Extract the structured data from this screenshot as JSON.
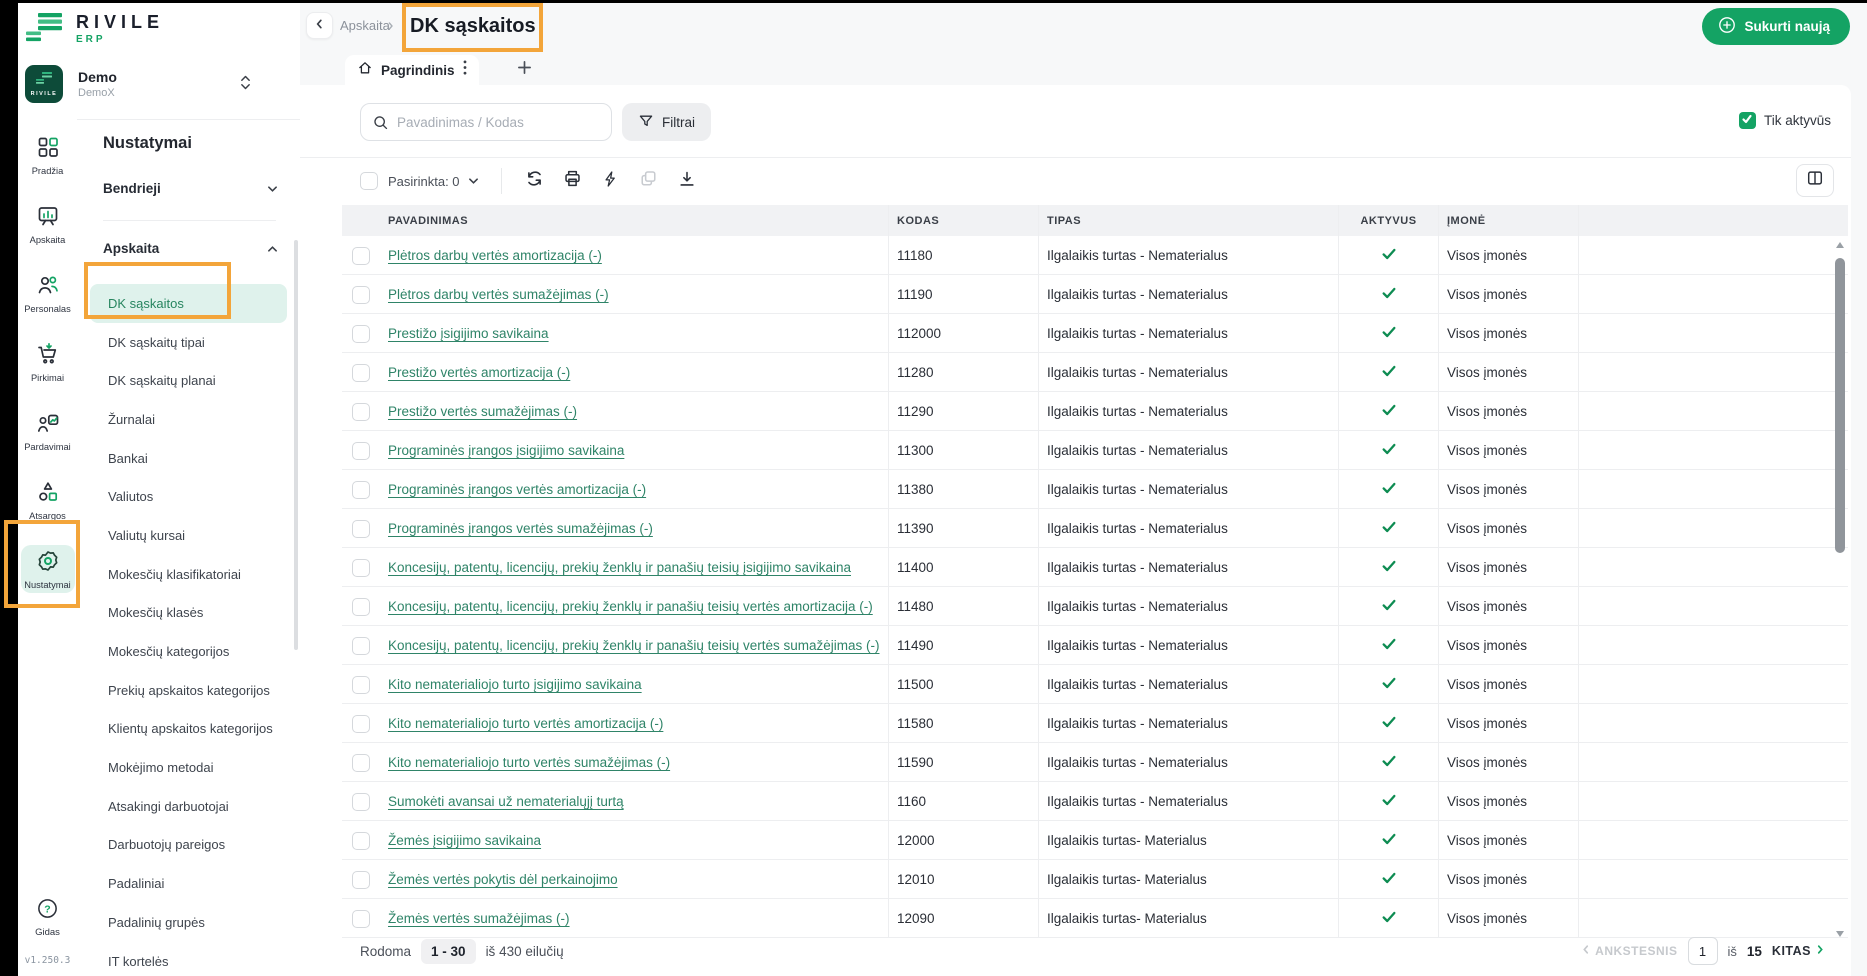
{
  "brand": {
    "name": "RIVILE",
    "suffix": "ERP"
  },
  "workspace": {
    "name": "Demo",
    "subtitle": "DemoX"
  },
  "rail": {
    "items": [
      {
        "label": "Pradžia",
        "icon": "dashboard-icon"
      },
      {
        "label": "Apskaita",
        "icon": "accounting-icon"
      },
      {
        "label": "Personalas",
        "icon": "people-icon"
      },
      {
        "label": "Pirkimai",
        "icon": "cart-icon"
      },
      {
        "label": "Pardavimai",
        "icon": "sales-icon"
      },
      {
        "label": "Atsargos",
        "icon": "inventory-shapes-icon"
      },
      {
        "label": "Nustatymai",
        "icon": "gear-icon",
        "active": true
      }
    ],
    "guide_label": "Gidas",
    "version": "v1.250.3"
  },
  "sidebar": {
    "title": "Nustatymai",
    "group_general": "Bendrieji",
    "group_accounting": "Apskaita",
    "items": [
      {
        "label": "DK sąskaitos",
        "active": true
      },
      {
        "label": "DK sąskaitų tipai"
      },
      {
        "label": "DK sąskaitų planai"
      },
      {
        "label": "Žurnalai"
      },
      {
        "label": "Bankai"
      },
      {
        "label": "Valiutos"
      },
      {
        "label": "Valiutų kursai"
      },
      {
        "label": "Mokesčių klasifikatoriai"
      },
      {
        "label": "Mokesčių klasės"
      },
      {
        "label": "Mokesčių kategorijos"
      },
      {
        "label": "Prekių apskaitos kategorijos"
      },
      {
        "label": "Klientų apskaitos kategorijos"
      },
      {
        "label": "Mokėjimo metodai"
      },
      {
        "label": "Atsakingi darbuotojai"
      },
      {
        "label": "Darbuotojų pareigos"
      },
      {
        "label": "Padaliniai"
      },
      {
        "label": "Padalinių grupės"
      },
      {
        "label": "IT kortelės"
      }
    ]
  },
  "header": {
    "breadcrumb_parent": "Apskaita",
    "title": "DK sąskaitos",
    "create_button": "Sukurti naują"
  },
  "tabs": {
    "active_label": "Pagrindinis"
  },
  "filters": {
    "search_placeholder": "Pavadinimas / Kodas",
    "filter_button": "Filtrai",
    "active_only_label": "Tik aktyvūs",
    "active_only_checked": true
  },
  "toolbar": {
    "selected_label": "Pasirinkta: 0"
  },
  "table": {
    "columns": {
      "name": "PAVADINIMAS",
      "code": "KODAS",
      "type": "TIPAS",
      "active": "AKTYVUS",
      "company": "ĮMONĖ"
    },
    "rows": [
      {
        "name": "Plėtros darbų vertės amortizacija (-)",
        "code": "11180",
        "type": "Ilgalaikis turtas - Nematerialus",
        "active": true,
        "company": "Visos įmonės"
      },
      {
        "name": "Plėtros darbų vertės sumažėjimas (-)",
        "code": "11190",
        "type": "Ilgalaikis turtas - Nematerialus",
        "active": true,
        "company": "Visos įmonės"
      },
      {
        "name": "Prestižo įsigijimo savikaina",
        "code": "112000",
        "type": "Ilgalaikis turtas - Nematerialus",
        "active": true,
        "company": "Visos įmonės"
      },
      {
        "name": "Prestižo vertės amortizacija (-)",
        "code": "11280",
        "type": "Ilgalaikis turtas - Nematerialus",
        "active": true,
        "company": "Visos įmonės"
      },
      {
        "name": "Prestižo vertės sumažėjimas (-)",
        "code": "11290",
        "type": "Ilgalaikis turtas - Nematerialus",
        "active": true,
        "company": "Visos įmonės"
      },
      {
        "name": "Programinės įrangos įsigijimo savikaina",
        "code": "11300",
        "type": "Ilgalaikis turtas - Nematerialus",
        "active": true,
        "company": "Visos įmonės"
      },
      {
        "name": "Programinės įrangos vertės amortizacija (-)",
        "code": "11380",
        "type": "Ilgalaikis turtas - Nematerialus",
        "active": true,
        "company": "Visos įmonės"
      },
      {
        "name": "Programinės įrangos vertės sumažėjimas (-)",
        "code": "11390",
        "type": "Ilgalaikis turtas - Nematerialus",
        "active": true,
        "company": "Visos įmonės"
      },
      {
        "name": "Koncesijų, patentų, licencijų, prekių ženklų ir panašių teisių įsigijimo savikaina",
        "code": "11400",
        "type": "Ilgalaikis turtas - Nematerialus",
        "active": true,
        "company": "Visos įmonės"
      },
      {
        "name": "Koncesijų, patentų, licencijų, prekių ženklų ir panašių teisių vertės amortizacija (-)",
        "code": "11480",
        "type": "Ilgalaikis turtas - Nematerialus",
        "active": true,
        "company": "Visos įmonės"
      },
      {
        "name": "Koncesijų, patentų, licencijų, prekių ženklų ir panašių teisių vertės sumažėjimas (-)",
        "code": "11490",
        "type": "Ilgalaikis turtas - Nematerialus",
        "active": true,
        "company": "Visos įmonės"
      },
      {
        "name": "Kito nematerialiojo turto įsigijimo savikaina",
        "code": "11500",
        "type": "Ilgalaikis turtas - Nematerialus",
        "active": true,
        "company": "Visos įmonės"
      },
      {
        "name": "Kito nematerialiojo turto vertės amortizacija (-)",
        "code": "11580",
        "type": "Ilgalaikis turtas - Nematerialus",
        "active": true,
        "company": "Visos įmonės"
      },
      {
        "name": "Kito nematerialiojo turto vertės sumažėjimas (-)",
        "code": "11590",
        "type": "Ilgalaikis turtas - Nematerialus",
        "active": true,
        "company": "Visos įmonės"
      },
      {
        "name": "Sumokėti avansai už nematerialųjį turtą",
        "code": "1160",
        "type": "Ilgalaikis turtas - Nematerialus",
        "active": true,
        "company": "Visos įmonės"
      },
      {
        "name": "Žemės įsigijimo savikaina",
        "code": "12000",
        "type": "Ilgalaikis turtas- Materialus",
        "active": true,
        "company": "Visos įmonės"
      },
      {
        "name": "Žemės vertės pokytis dėl perkainojimo",
        "code": "12010",
        "type": "Ilgalaikis turtas- Materialus",
        "active": true,
        "company": "Visos įmonės"
      },
      {
        "name": "Žemės vertės sumažėjimas (-)",
        "code": "12090",
        "type": "Ilgalaikis turtas- Materialus",
        "active": true,
        "company": "Visos įmonės"
      }
    ]
  },
  "footer": {
    "showing_label": "Rodoma",
    "range": "1 - 30",
    "total_label": "iš 430 eilučių",
    "prev_label": "ANKSTESNIS",
    "page_value": "1",
    "of_label": "iš",
    "pages_total": "15",
    "next_label": "KITAS"
  },
  "colors": {
    "accent_green": "#14A364",
    "link_green": "#2F8468",
    "check_green": "#0E8C52",
    "active_item_bg": "#DFF2EC",
    "annotation_orange": "#F3A53A"
  }
}
